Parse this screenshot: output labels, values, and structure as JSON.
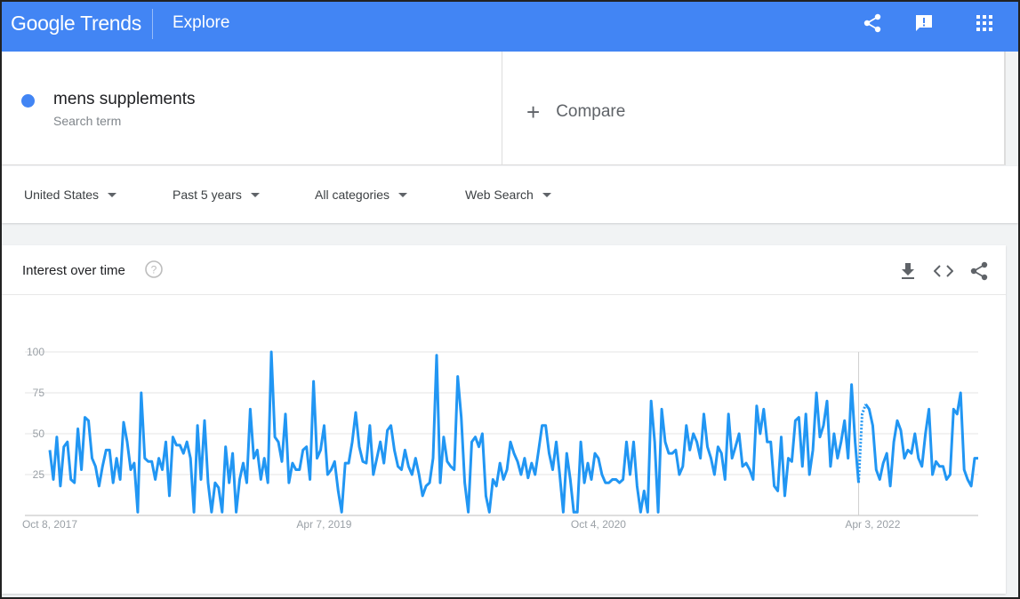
{
  "header": {
    "logo_google": "Google",
    "logo_trends": "Trends",
    "section": "Explore",
    "icons": [
      "share-icon",
      "feedback-icon",
      "apps-grid-icon"
    ]
  },
  "search": {
    "term": "mens supplements",
    "term_type": "Search term",
    "compare_label": "Compare",
    "term_color": "#4285f4"
  },
  "filters": {
    "region": "United States",
    "period": "Past 5 years",
    "category": "All categories",
    "property": "Web Search"
  },
  "card": {
    "title": "Interest over time",
    "icons": [
      "help-icon",
      "download-icon",
      "embed-code-icon",
      "share-icon"
    ]
  },
  "chart_data": {
    "type": "line",
    "title": "",
    "xlabel": "",
    "ylabel": "",
    "ylim": [
      0,
      100
    ],
    "y_ticks": [
      25,
      50,
      75,
      100
    ],
    "x_tick_labels": [
      "Oct 8, 2017",
      "Apr 7, 2019",
      "Oct 4, 2020",
      "Apr 3, 2022"
    ],
    "x_tick_indices": [
      0,
      78,
      156,
      234
    ],
    "grid": true,
    "series_color": "#2196f3",
    "partial_data_from_index": 230,
    "series": [
      {
        "values": [
          40,
          22,
          48,
          18,
          42,
          45,
          22,
          20,
          53,
          28,
          60,
          58,
          35,
          30,
          18,
          30,
          40,
          40,
          20,
          35,
          22,
          57,
          45,
          28,
          32,
          2,
          75,
          35,
          33,
          33,
          22,
          35,
          28,
          45,
          12,
          48,
          43,
          43,
          38,
          45,
          35,
          2,
          55,
          22,
          58,
          20,
          2,
          20,
          17,
          2,
          42,
          20,
          38,
          2,
          22,
          32,
          20,
          65,
          35,
          40,
          22,
          35,
          20,
          100,
          48,
          45,
          33,
          62,
          20,
          32,
          28,
          28,
          40,
          42,
          22,
          82,
          35,
          40,
          55,
          25,
          28,
          33,
          15,
          2,
          32,
          32,
          45,
          63,
          42,
          33,
          32,
          55,
          25,
          35,
          45,
          32,
          52,
          55,
          40,
          30,
          28,
          40,
          30,
          25,
          35,
          25,
          12,
          18,
          20,
          35,
          98,
          20,
          48,
          33,
          30,
          28,
          85,
          60,
          20,
          2,
          45,
          48,
          42,
          50,
          12,
          2,
          22,
          18,
          32,
          22,
          28,
          45,
          38,
          33,
          25,
          35,
          23,
          32,
          25,
          40,
          55,
          55,
          38,
          28,
          45,
          25,
          2,
          38,
          22,
          2,
          2,
          45,
          20,
          32,
          22,
          38,
          35,
          25,
          20,
          20,
          22,
          22,
          20,
          22,
          45,
          25,
          45,
          18,
          2,
          15,
          2,
          70,
          45,
          2,
          65,
          45,
          38,
          38,
          40,
          25,
          30,
          55,
          40,
          50,
          45,
          35,
          62,
          42,
          35,
          25,
          42,
          38,
          22,
          62,
          35,
          42,
          50,
          30,
          32,
          28,
          22,
          67,
          50,
          65,
          45,
          45,
          18,
          15,
          48,
          12,
          35,
          33,
          58,
          60,
          30,
          62,
          25,
          40,
          75,
          48,
          55,
          70,
          30,
          50,
          35,
          45,
          58,
          35,
          80,
          45,
          20,
          62,
          68,
          65,
          55,
          28,
          22,
          32,
          38,
          18,
          45,
          58,
          52,
          35,
          40,
          38,
          50,
          35,
          30,
          50,
          65,
          25,
          33,
          30,
          30,
          22,
          25,
          65,
          62,
          75,
          28,
          22,
          18,
          35,
          35
        ]
      }
    ]
  }
}
